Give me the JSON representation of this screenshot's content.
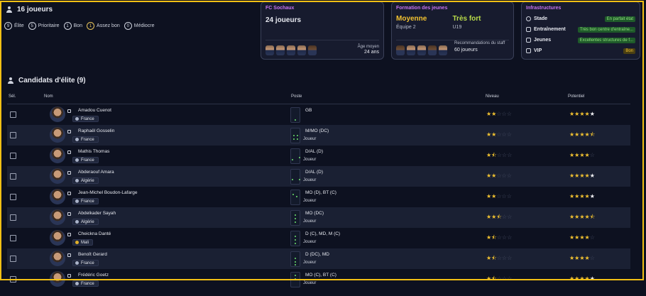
{
  "summary": {
    "title": "16 joueurs",
    "legend": [
      {
        "n": "9",
        "label": "Élite",
        "gold": false
      },
      {
        "n": "5",
        "label": "Prioritaire",
        "gold": false
      },
      {
        "n": "1",
        "label": "Bon",
        "gold": false
      },
      {
        "n": "1",
        "label": "Assez bon",
        "gold": true
      },
      {
        "n": "0",
        "label": "Médiocre",
        "gold": false
      }
    ]
  },
  "club": {
    "title": "FC Sochaux",
    "count": "24 joueurs",
    "age_label": "Âge moyen",
    "age_value": "24 ans"
  },
  "youth": {
    "title": "Formation des jeunes",
    "left_value": "Moyenne",
    "left_sub": "Équipe 2",
    "right_value": "Très fort",
    "right_sub": "U19",
    "rec_label": "Recommandations du staff",
    "rec_value": "60 joueurs"
  },
  "infra": {
    "title": "Infrastructures",
    "rows": [
      {
        "label": "Stade",
        "value": "En parfait état",
        "icon": "eye-icon",
        "gold": false
      },
      {
        "label": "Entraînement",
        "value": "Très bon centre d'entraîne...",
        "icon": "training-icon",
        "gold": false
      },
      {
        "label": "Jeunes",
        "value": "Excellentes structures de f...",
        "icon": "youth-icon",
        "gold": false
      },
      {
        "label": "VIP",
        "value": "Bon",
        "icon": "vip-icon",
        "gold": true
      }
    ]
  },
  "section": {
    "title": "Candidats d'élite (9)"
  },
  "table": {
    "headers": {
      "sel": "Sél.",
      "name": "Nom",
      "pos": "Poste",
      "level": "Niveau",
      "potential": "Potentiel"
    },
    "rows": [
      {
        "name": "Amadou Cuenot",
        "nation": "France",
        "pos": "GB",
        "role": "",
        "level": 2,
        "potential": 5
      },
      {
        "name": "Raphaël Gosselin",
        "nation": "France",
        "pos": "M/MO (DC)",
        "role": "Joueur",
        "level": 2,
        "potential": 4.5
      },
      {
        "name": "Mathis Thomas",
        "nation": "France",
        "pos": "D/AL (D)",
        "role": "Joueur",
        "level": 1.5,
        "potential": 4
      },
      {
        "name": "Abderaouf Amara",
        "nation": "Algérie",
        "pos": "D/AL (D)",
        "role": "Joueur",
        "level": 2,
        "potential": 5
      },
      {
        "name": "Jean-Michel Boudon-Lafarge",
        "nation": "France",
        "pos": "MO (D), BT (C)",
        "role": "Joueur",
        "level": 2,
        "potential": 5
      },
      {
        "name": "Abdelkader Sayah",
        "nation": "Algérie",
        "pos": "MO (DC)",
        "role": "Joueur",
        "level": 2.5,
        "potential": 4.5
      },
      {
        "name": "Cheickna Danté",
        "nation": "Mali",
        "pos": "D (C), MD, M (C)",
        "role": "Joueur",
        "level": 1.5,
        "potential": 4
      },
      {
        "name": "Benoît Gerard",
        "nation": "France",
        "pos": "D (DC), MD",
        "role": "Joueur",
        "level": 1.5,
        "potential": 4
      },
      {
        "name": "Frédéric Goetz",
        "nation": "France",
        "pos": "MO (C), BT (C)",
        "role": "Joueur",
        "level": 1.5,
        "potential": 5
      }
    ]
  }
}
